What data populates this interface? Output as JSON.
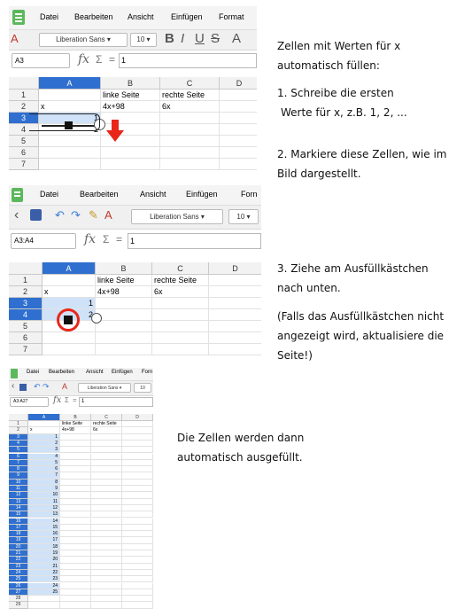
{
  "menu": [
    "Datei",
    "Bearbeiten",
    "Ansicht",
    "Einfügen",
    "Format"
  ],
  "menu2_last": "Forn",
  "toolbar": {
    "font": "Liberation Sans",
    "size": "10"
  },
  "panel1": {
    "namebox": "A3",
    "formula": "1",
    "columns": [
      "A",
      "B",
      "C",
      "D"
    ],
    "rows": [
      "1",
      "2",
      "3",
      "4",
      "5",
      "6",
      "7"
    ],
    "cells": {
      "B1": "linke Seite",
      "C1": "rechte Seite",
      "A2": "x",
      "B2": "4x+98",
      "C2": "6x",
      "A3": "1",
      "A4": "2"
    }
  },
  "panel2": {
    "namebox": "A3:A4",
    "formula": "1",
    "columns": [
      "A",
      "B",
      "C",
      "D"
    ],
    "rows": [
      "1",
      "2",
      "3",
      "4",
      "5",
      "6",
      "7"
    ],
    "cells": {
      "B1": "linke Seite",
      "C1": "rechte Seite",
      "A2": "x",
      "B2": "4x+98",
      "C2": "6x",
      "A3": "1",
      "A4": "2"
    }
  },
  "panel3": {
    "namebox": "A3:A27",
    "formula": "1",
    "columns": [
      "A",
      "B",
      "C",
      "D"
    ],
    "rows": [
      "1",
      "2",
      "3",
      "4",
      "5",
      "6",
      "7",
      "8",
      "9",
      "10",
      "11",
      "12",
      "13",
      "14",
      "15",
      "16",
      "17",
      "18",
      "19",
      "20",
      "21",
      "22",
      "23",
      "24",
      "25",
      "26",
      "27",
      "28",
      "29"
    ],
    "cells": {
      "B1": "linke Seite",
      "C1": "rechte Seite",
      "A2": "x",
      "B2": "4x+98",
      "C2": "6x"
    },
    "values": [
      "1",
      "2",
      "3",
      "4",
      "5",
      "6",
      "7",
      "8",
      "9",
      "10",
      "11",
      "12",
      "13",
      "14",
      "15",
      "16",
      "17",
      "18",
      "19",
      "20",
      "21",
      "22",
      "23",
      "24",
      "25"
    ]
  },
  "instructions": {
    "title_l1": "Zellen mit Werten für x",
    "title_l2": "automatisch füllen:",
    "s1_l1": "1. Schreibe die ersten",
    "s1_l2": "Werte für x, z.B. 1, 2, ...",
    "s2_l1": "2. Markiere diese Zellen, wie im",
    "s2_l2": "Bild dargestellt.",
    "s3_l1": "3. Ziehe am Ausfüllkästchen",
    "s3_l2": "nach unten.",
    "note_l1": "(Falls das Ausfüllkästchen nicht",
    "note_l2": "angezeigt wird, aktualisiere die",
    "note_l3": "Seite!)",
    "final_l1": "Die Zellen werden dann",
    "final_l2": "automatisch ausgefüllt."
  },
  "colors": {
    "selection": "#cfe2f7",
    "header_selected": "#2f6fcf",
    "arrow": "#e8261a",
    "circle": "#e8261a",
    "app_green": "#5cb85c"
  }
}
